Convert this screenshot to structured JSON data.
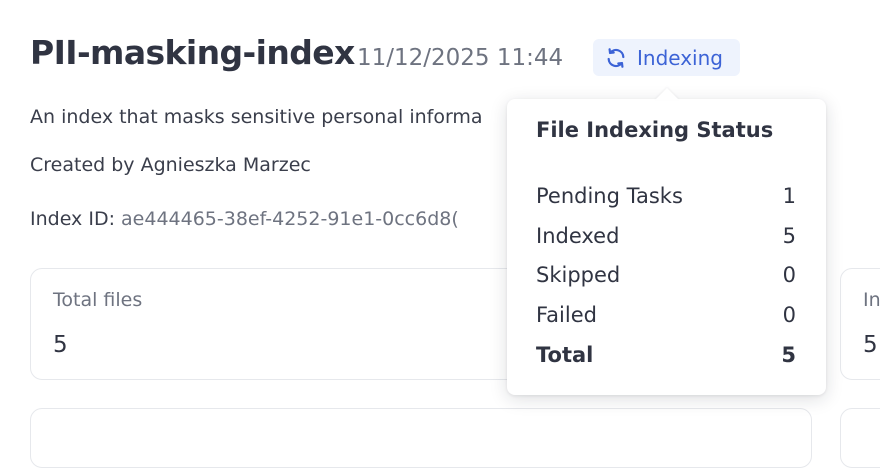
{
  "header": {
    "title": "PII-masking-index",
    "timestamp": "11/12/2025 11:44",
    "status_label": "Indexing",
    "status_icon": "refresh-icon",
    "accent_color": "#3c63d6"
  },
  "info": {
    "description": "An index that masks sensitive personal informa",
    "created_by": "Created by Agnieszka Marzec",
    "index_id_label": "Index ID:",
    "index_id_value": "ae444465-38ef-4252-91e1-0cc6d8("
  },
  "cards": [
    {
      "label": "Total files",
      "value": "5"
    },
    {
      "label": "In",
      "value": "5"
    }
  ],
  "popover": {
    "title": "File Indexing Status",
    "rows": [
      {
        "label": "Pending Tasks",
        "value": "1"
      },
      {
        "label": "Indexed",
        "value": "5"
      },
      {
        "label": "Skipped",
        "value": "0"
      },
      {
        "label": "Failed",
        "value": "0"
      },
      {
        "label": "Total",
        "value": "5"
      }
    ]
  }
}
